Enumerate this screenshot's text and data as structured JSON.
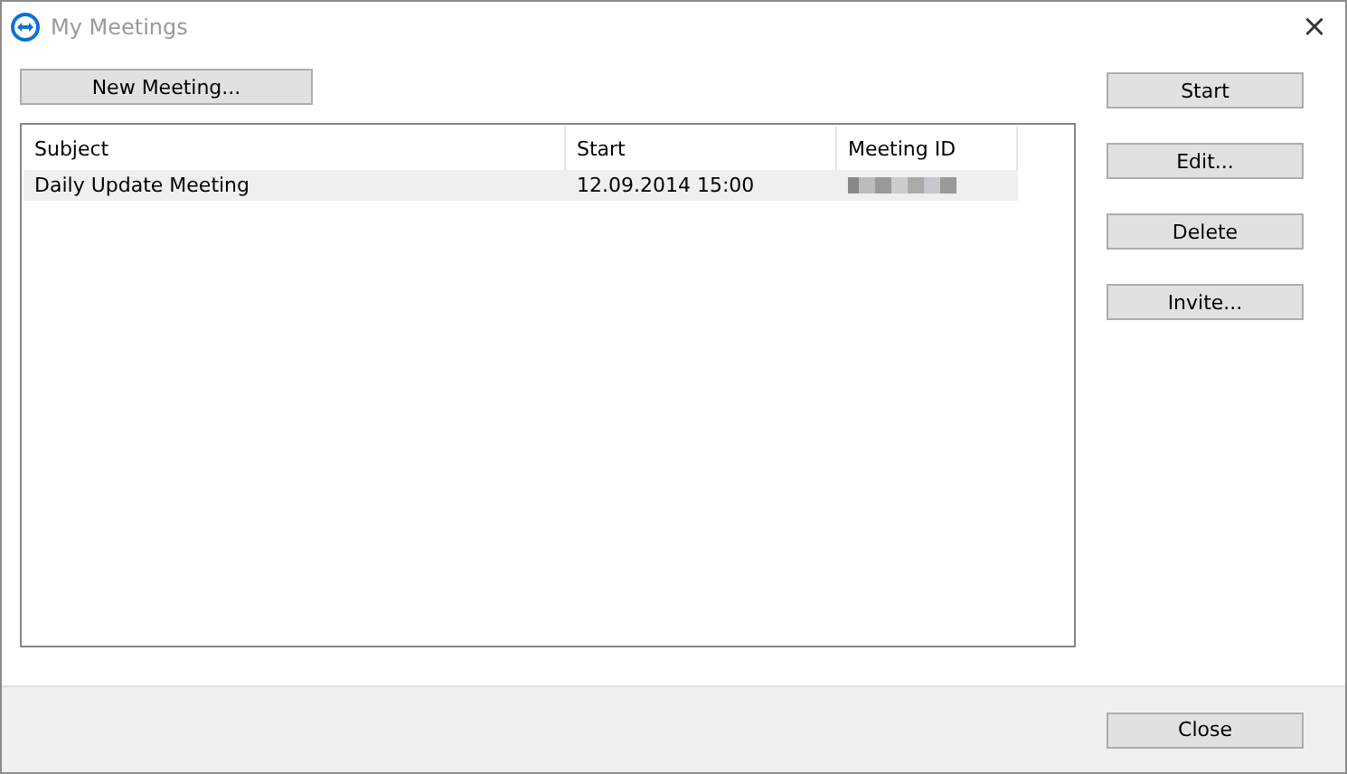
{
  "window": {
    "title": "My Meetings",
    "close": "×"
  },
  "new_meeting_button": "New Meeting...",
  "table": {
    "columns": [
      "Subject",
      "Start",
      "Meeting ID"
    ],
    "rows": [
      {
        "subject": "Daily Update Meeting",
        "start": "12.09.2014 15:00",
        "selected": true
      }
    ]
  },
  "side_buttons": [
    "Start",
    "Edit...",
    "Delete",
    "Invite..."
  ],
  "footer_button": "Close"
}
